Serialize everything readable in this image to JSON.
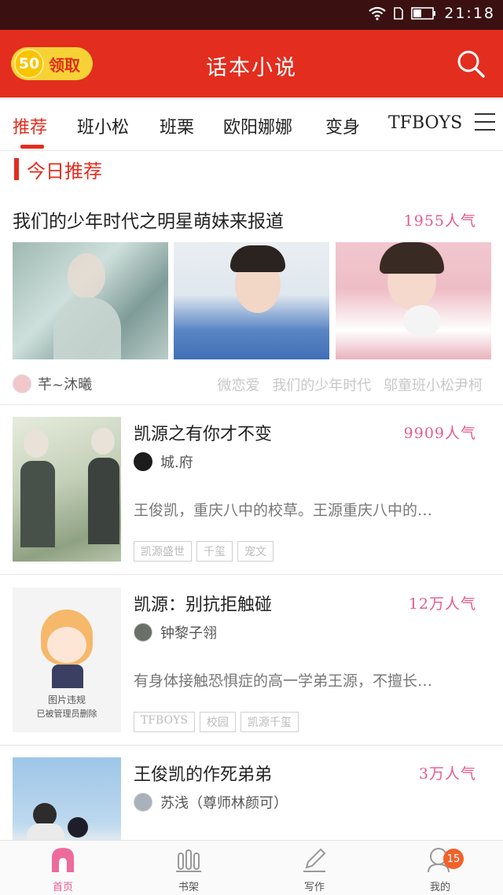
{
  "status_bar": {
    "time": "21:18"
  },
  "header": {
    "claim_count": "50",
    "claim_label": "领取",
    "app_title": "话本小说"
  },
  "tabs": [
    "推荐",
    "班小松",
    "班栗",
    "欧阳娜娜",
    "变身",
    "TFBOYS"
  ],
  "section": {
    "title": "今日推荐"
  },
  "featured": {
    "title": "我们的少年时代之明星萌妹来报道",
    "popularity": "1955人气",
    "author": "芊~沐曦",
    "tags": [
      "微恋爱",
      "我们的少年时代",
      "邬童班小松尹柯"
    ]
  },
  "books": [
    {
      "title": "凯源之有你才不变",
      "popularity": "9909人气",
      "author": "城.府",
      "description": "王俊凯，重庆八中的校草。王源重庆八中的…",
      "tags": [
        "凯源盛世",
        "千玺",
        "宠文"
      ]
    },
    {
      "title": "凯源：别抗拒触碰",
      "popularity": "12万人气",
      "author": "钟黎子翎",
      "description": "有身体接触恐惧症的高一学弟王源，不擅长…",
      "tags": [
        "TFBOYS",
        "校园",
        "凯源千玺"
      ]
    },
    {
      "title": "王俊凯的作死弟弟",
      "popularity": "3万人气",
      "author": "苏浅（尊师林颜可）",
      "description": "",
      "tags": []
    }
  ],
  "cover_texts": {
    "book2_line1": "图片违规",
    "book2_line2": "已被管理员删除"
  },
  "bottom_nav": [
    {
      "label": "首页",
      "icon": "home-icon"
    },
    {
      "label": "书架",
      "icon": "bookshelf-icon"
    },
    {
      "label": "写作",
      "icon": "pencil-icon"
    },
    {
      "label": "我的",
      "icon": "profile-icon",
      "badge": "15"
    }
  ],
  "colors": {
    "header": "#e32d1e",
    "accent": "#e32d1e",
    "popularity": "#e85a8e"
  }
}
